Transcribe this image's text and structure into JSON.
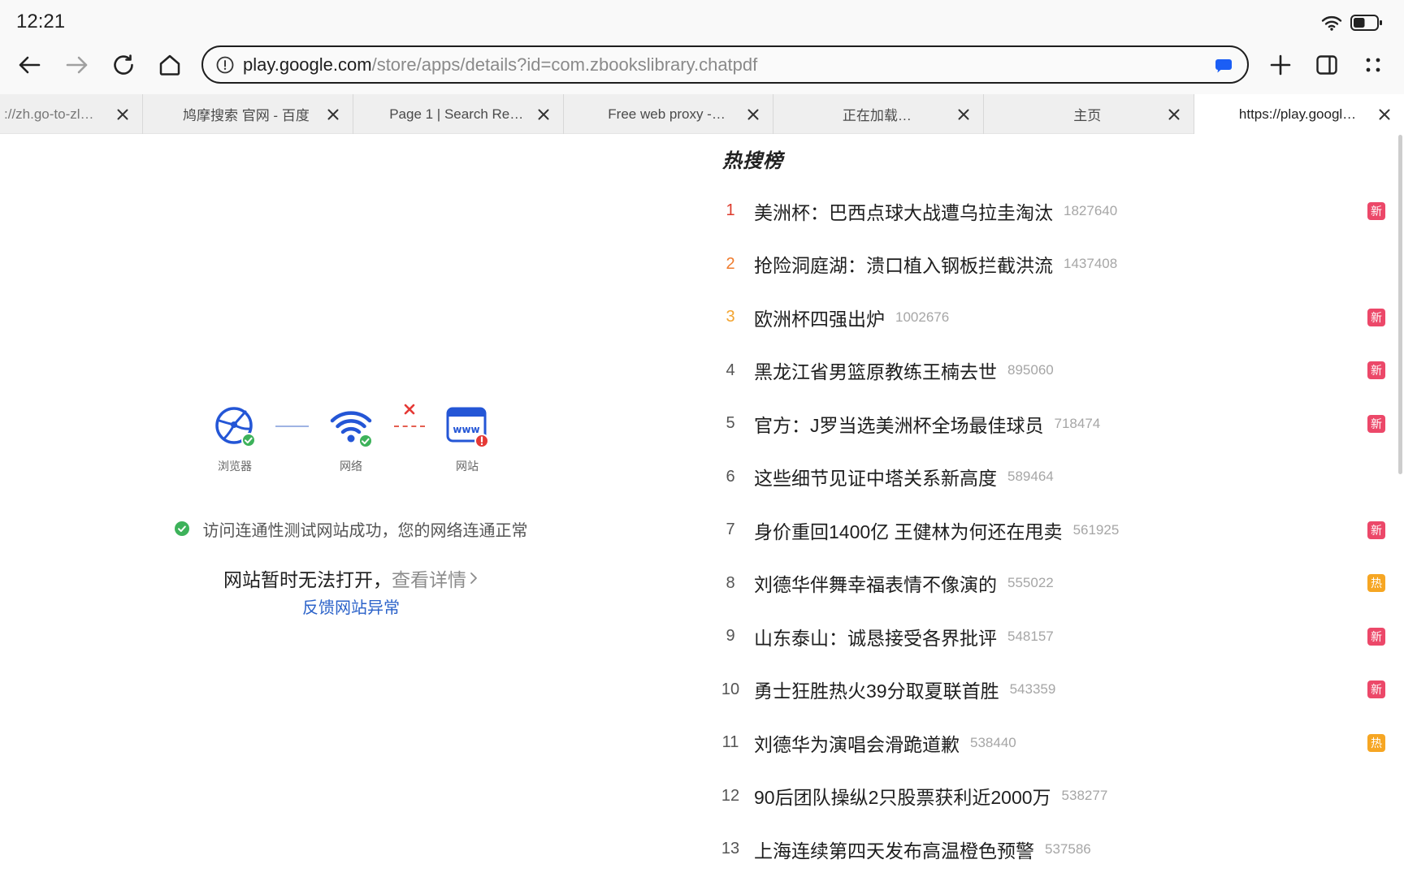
{
  "status_bar": {
    "time": "12:21",
    "battery_level": 0.5,
    "icons": [
      "wifi-icon",
      "battery-icon"
    ]
  },
  "toolbar": {
    "url_host": "play.google.com",
    "url_path": "/store/apps/details?id=com.zbookslibrary.chatpdf",
    "icons": [
      "back-arrow-icon",
      "forward-arrow-icon",
      "reload-icon",
      "home-icon",
      "site-info-icon",
      "reader-mode-icon",
      "new-tab-plus-icon",
      "split-screen-icon",
      "more-grid-icon"
    ]
  },
  "tabs": [
    {
      "label": "://zh.go-to-zl…",
      "active": false
    },
    {
      "label": "鸠摩搜索 官网 - 百度",
      "active": false
    },
    {
      "label": "Page 1 | Search Re…",
      "active": false
    },
    {
      "label": "Free web proxy -…",
      "active": false
    },
    {
      "label": "正在加载…",
      "active": false
    },
    {
      "label": "主页",
      "active": false
    },
    {
      "label": "https://play.googl…",
      "active": true
    }
  ],
  "error_page": {
    "diagram": {
      "browser_label": "浏览器",
      "network_label": "网络",
      "website_label": "网站",
      "www_icon_text": "www"
    },
    "connectivity_message": "访问连通性测试网站成功，您的网络连通正常",
    "error_title": "网站暂时无法打开，",
    "details_link": "查看详情",
    "feedback_link": "反馈网站异常"
  },
  "hot_search": {
    "title": "热搜榜",
    "items": [
      {
        "rank": 1,
        "title": "美洲杯：巴西点球大战遭乌拉圭淘汰",
        "count": "1827640",
        "badge": "新"
      },
      {
        "rank": 2,
        "title": "抢险洞庭湖：溃口植入钢板拦截洪流",
        "count": "1437408"
      },
      {
        "rank": 3,
        "title": "欧洲杯四强出炉",
        "count": "1002676",
        "badge": "新"
      },
      {
        "rank": 4,
        "title": "黑龙江省男篮原教练王楠去世",
        "count": "895060",
        "badge": "新"
      },
      {
        "rank": 5,
        "title": "官方：J罗当选美洲杯全场最佳球员",
        "count": "718474",
        "badge": "新"
      },
      {
        "rank": 6,
        "title": "这些细节见证中塔关系新高度",
        "count": "589464"
      },
      {
        "rank": 7,
        "title": "身价重回1400亿 王健林为何还在甩卖",
        "count": "561925",
        "badge": "新"
      },
      {
        "rank": 8,
        "title": "刘德华伴舞幸福表情不像演的",
        "count": "555022",
        "badge": "热"
      },
      {
        "rank": 9,
        "title": "山东泰山：诚恳接受各界批评",
        "count": "548157",
        "badge": "新"
      },
      {
        "rank": 10,
        "title": "勇士狂胜热火39分取夏联首胜",
        "count": "543359",
        "badge": "新"
      },
      {
        "rank": 11,
        "title": "刘德华为演唱会滑跪道歉",
        "count": "538440",
        "badge": "热"
      },
      {
        "rank": 12,
        "title": "90后团队操纵2只股票获利近2000万",
        "count": "538277"
      },
      {
        "rank": 13,
        "title": "上海连续第四天发布高温橙色预警",
        "count": "537586"
      }
    ]
  },
  "colors": {
    "accent_blue": "#2456d6",
    "link_blue": "#2b62c9",
    "success_green": "#3db25a",
    "error_red": "#e53935",
    "reader_icon_blue": "#1b5ef5",
    "rank": {
      "1": "#dd3a2c",
      "2": "#ef7b2d",
      "3": "#f3a430",
      "default": "#555555"
    },
    "badge": {
      "新": "#ec4869",
      "热": "#f6a623"
    }
  }
}
